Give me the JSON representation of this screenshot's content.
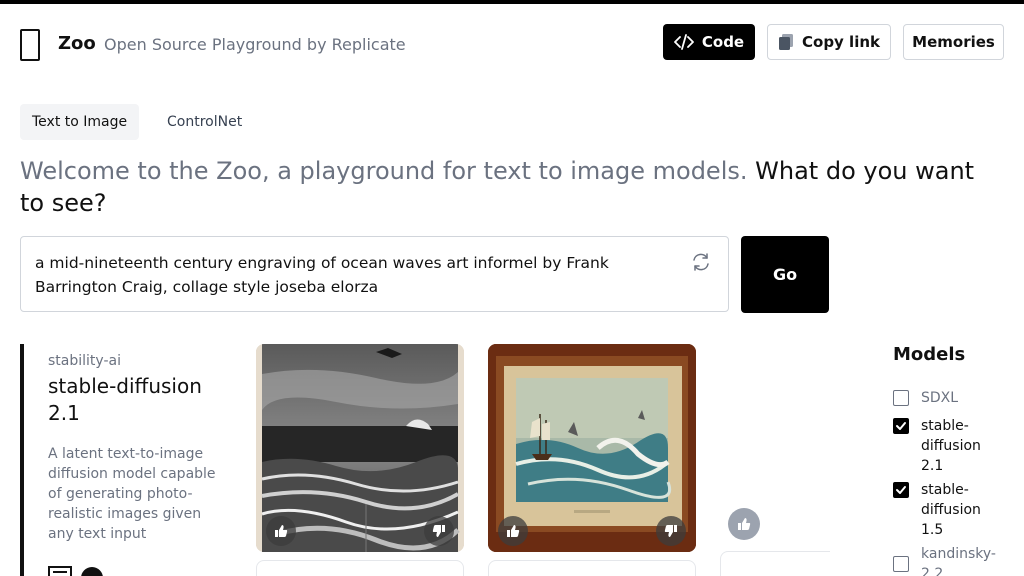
{
  "header": {
    "brand": "Zoo",
    "tagline": "Open Source Playground by Replicate",
    "buttons": {
      "code": "Code",
      "copy_link": "Copy link",
      "memories": "Memories"
    }
  },
  "tabs": [
    {
      "label": "Text to Image",
      "active": true
    },
    {
      "label": "ControlNet",
      "active": false
    }
  ],
  "headline": {
    "muted": "Welcome to the Zoo, a playground for text to image models.",
    "strong": "What do you want to see?"
  },
  "prompt": {
    "value": "a mid-nineteenth century engraving of ocean waves art informel by Frank Barrington Craig, collage style joseba elorza",
    "submit_label": "Go"
  },
  "model_card": {
    "owner": "stability-ai",
    "name": "stable-diffusion 2.1",
    "description": "A latent text-to-image diffusion model capable of generating photo-realistic images given any text input"
  },
  "models_panel": {
    "title": "Models",
    "items": [
      {
        "label": "SDXL",
        "checked": false
      },
      {
        "label": "stable-diffusion 2.1",
        "checked": true
      },
      {
        "label": "stable-diffusion 1.5",
        "checked": true
      },
      {
        "label": "kandinsky-2.2",
        "checked": false
      }
    ]
  },
  "colors": {
    "primary": "#000000",
    "muted_text": "#6b7280",
    "border": "#d1d5db",
    "tab_active_bg": "#f3f4f6"
  }
}
